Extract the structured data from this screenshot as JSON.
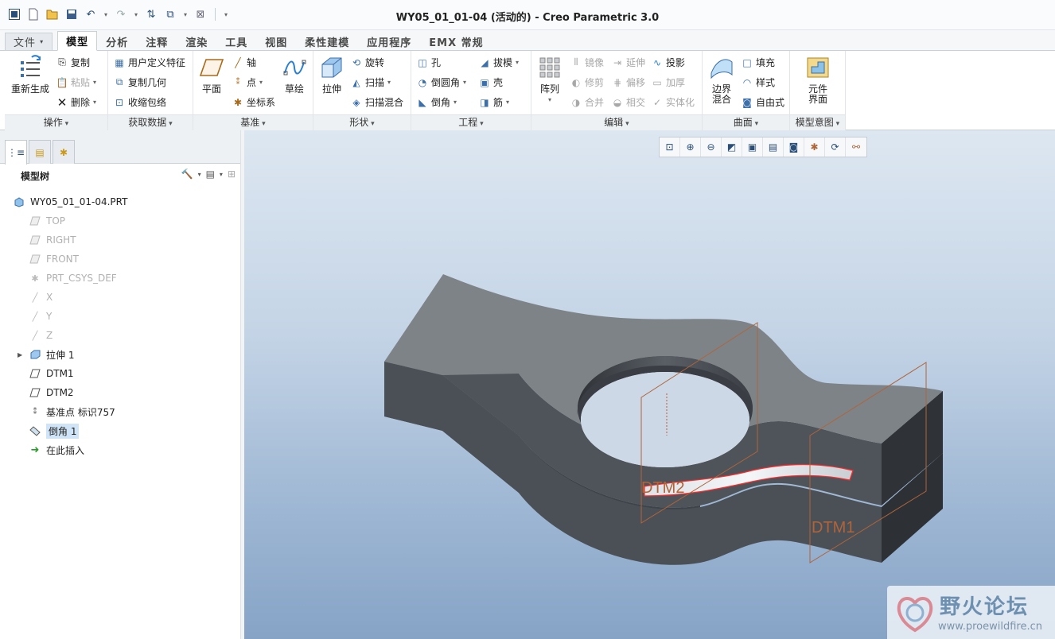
{
  "window": {
    "title": "WY05_01_01-04 (活动的) - Creo Parametric 3.0"
  },
  "quick_access": {
    "icons": [
      "window-icon",
      "new-icon",
      "open-icon",
      "save-icon",
      "undo-icon",
      "redo-icon",
      "regenerate-icon",
      "windows-icon",
      "close-window-icon",
      "customize-icon"
    ]
  },
  "tabs": [
    {
      "label": "文件",
      "active": false,
      "is_file": true
    },
    {
      "label": "模型",
      "active": true
    },
    {
      "label": "分析",
      "active": false
    },
    {
      "label": "注释",
      "active": false
    },
    {
      "label": "渲染",
      "active": false
    },
    {
      "label": "工具",
      "active": false
    },
    {
      "label": "视图",
      "active": false
    },
    {
      "label": "柔性建模",
      "active": false
    },
    {
      "label": "应用程序",
      "active": false
    },
    {
      "label": "EMX 常规",
      "active": false
    }
  ],
  "ribbon": {
    "operations": {
      "label": "操作",
      "regenerate": "重新生成",
      "copy": "复制",
      "paste": "粘贴",
      "delete": "删除"
    },
    "get_data": {
      "label": "获取数据",
      "udf": "用户定义特征",
      "copy_geom": "复制几何",
      "shrinkwrap": "收缩包络"
    },
    "datum": {
      "label": "基准",
      "plane": "平面",
      "axis": "轴",
      "point": "点",
      "csys": "坐标系",
      "sketch": "草绘"
    },
    "shapes": {
      "label": "形状",
      "extrude": "拉伸",
      "revolve": "旋转",
      "sweep": "扫描",
      "swept_blend": "扫描混合"
    },
    "engineering": {
      "label": "工程",
      "hole": "孔",
      "round": "倒圆角",
      "chamfer": "倒角",
      "draft": "拔模",
      "shell": "壳",
      "rib": "筋"
    },
    "editing": {
      "label": "编辑",
      "pattern": "阵列",
      "mirror": "镜像",
      "trim": "修剪",
      "merge": "合并",
      "extend": "延伸",
      "offset": "偏移",
      "intersect": "相交",
      "project": "投影",
      "thicken": "加厚",
      "solidify": "实体化"
    },
    "surfaces": {
      "label": "曲面",
      "boundary_blend_1": "边界",
      "boundary_blend_2": "混合",
      "fill": "填充",
      "style": "样式",
      "freestyle": "自由式"
    },
    "model_intent": {
      "label": "模型意图",
      "component_interface_1": "元件",
      "component_interface_2": "界面"
    }
  },
  "model_tree": {
    "title": "模型树",
    "nodes": [
      {
        "label": "WY05_01_01-04.PRT",
        "icon": "part-icon",
        "level": 0,
        "hidden": false
      },
      {
        "label": "TOP",
        "icon": "datum-plane-icon",
        "level": 1,
        "hidden": true
      },
      {
        "label": "RIGHT",
        "icon": "datum-plane-icon",
        "level": 1,
        "hidden": true
      },
      {
        "label": "FRONT",
        "icon": "datum-plane-icon",
        "level": 1,
        "hidden": true
      },
      {
        "label": "PRT_CSYS_DEF",
        "icon": "csys-icon",
        "level": 1,
        "hidden": true
      },
      {
        "label": "X",
        "icon": "axis-icon",
        "level": 1,
        "hidden": true
      },
      {
        "label": "Y",
        "icon": "axis-icon",
        "level": 1,
        "hidden": true
      },
      {
        "label": "Z",
        "icon": "axis-icon",
        "level": 1,
        "hidden": true
      },
      {
        "label": "拉伸 1",
        "icon": "extrude-icon",
        "level": 1,
        "hidden": false,
        "expandable": true
      },
      {
        "label": "DTM1",
        "icon": "datum-plane-icon",
        "level": 1,
        "hidden": false
      },
      {
        "label": "DTM2",
        "icon": "datum-plane-icon",
        "level": 1,
        "hidden": false
      },
      {
        "label": "基准点 标识757",
        "icon": "datum-point-icon",
        "level": 1,
        "hidden": false
      },
      {
        "label": "倒角 1",
        "icon": "chamfer-icon",
        "level": 1,
        "hidden": false,
        "selected": true
      },
      {
        "label": "在此插入",
        "icon": "insert-here-icon",
        "level": 1,
        "hidden": false
      }
    ]
  },
  "view_toolbar": {
    "icons": [
      "refit-icon",
      "zoom-in-icon",
      "zoom-out-icon",
      "repaint-icon",
      "display-style-icon",
      "saved-orientations-icon",
      "view-manager-icon",
      "datum-display-icon",
      "spin-center-icon",
      "annotation-display-icon"
    ]
  },
  "viewport": {
    "datum_labels": [
      "DTM2",
      "DTM1"
    ]
  },
  "watermark": {
    "text": "野火论坛",
    "url": "www.proewildfire.cn"
  },
  "colors": {
    "accent": "#2a4e78",
    "selection_highlight": "#cfe4f6",
    "datum_plane": "#b0643a",
    "edge_highlight": "#ff2a2a",
    "model_top": "#7d8287",
    "model_side": "#4b5056"
  }
}
